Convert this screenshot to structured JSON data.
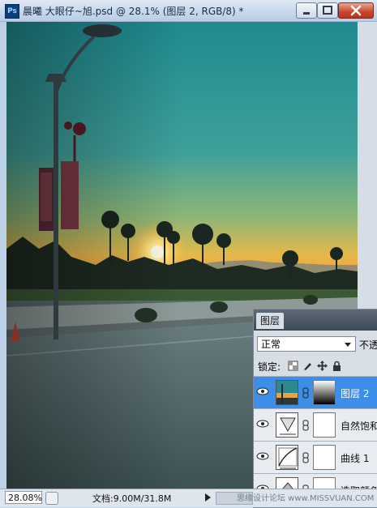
{
  "app": {
    "icon_text": "Ps",
    "title": "晨曦  大眼仔~旭.psd @ 28.1% (图层 2, RGB/8) *"
  },
  "status": {
    "zoom": "28.08%",
    "doc_info": "文档:9.00M/31.8M"
  },
  "layers_panel": {
    "tab": "图层",
    "blend_mode": "正常",
    "opacity_label": "不透",
    "lock_label": "锁定:",
    "layers": [
      {
        "name": "图层 2",
        "selected": true,
        "thumb": "photo"
      },
      {
        "name": "自然饱和",
        "selected": false,
        "thumb": "vibrance"
      },
      {
        "name": "曲线 1",
        "selected": false,
        "thumb": "curves"
      },
      {
        "name": "选取颜色",
        "selected": false,
        "thumb": "selective-color"
      }
    ]
  },
  "watermark": "思缘设计论坛 www.MISSVUAN.COM",
  "colors": {
    "accent": "#3d8ee8",
    "titlebar": "#c7d8ec",
    "close": "#c9452c"
  }
}
